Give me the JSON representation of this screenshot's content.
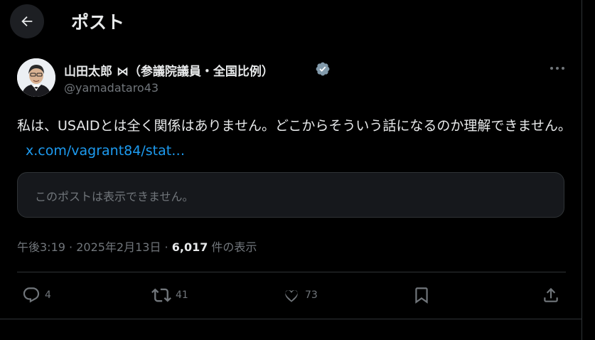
{
  "header": {
    "title": "ポスト",
    "back_icon": "arrow-left-icon"
  },
  "author": {
    "name": "山田太郎 ⋈（参議院議員・全国比例）",
    "handle": "@yamadataro43",
    "verified": true,
    "verified_color": "#829aab"
  },
  "tweet": {
    "text": "私は、USAIDとは全く関係はありません。どこからそういう話になるのか理解できません。",
    "link": "x.com/vagrant84/stat…",
    "link_color": "#1d9bf0",
    "unavailable_notice": "このポストは表示できません。"
  },
  "meta": {
    "time": "午後3:19",
    "separator": " · ",
    "date": "2025年2月13日",
    "views_count": "6,017",
    "views_label": " 件の表示"
  },
  "actions": {
    "replies": "4",
    "reposts": "41",
    "likes": "73"
  }
}
